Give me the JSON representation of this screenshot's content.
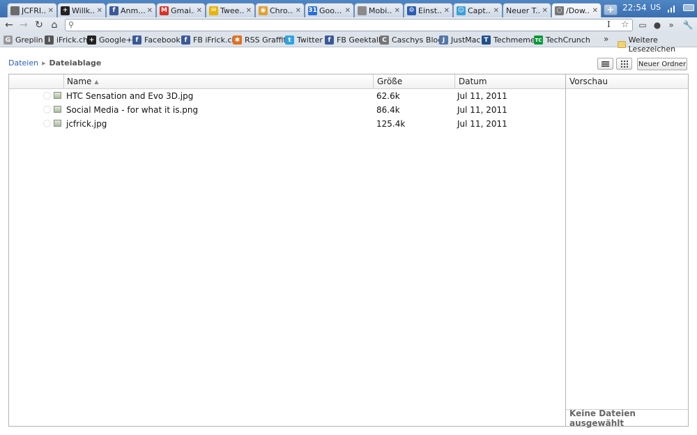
{
  "tabs": [
    {
      "title": "JCFRI...",
      "icon": "site-icon",
      "color": "#6b6b6b",
      "glyph": ""
    },
    {
      "title": "Willk...",
      "icon": "google-plus-icon",
      "color": "#222222",
      "glyph": "+"
    },
    {
      "title": "Anm...",
      "icon": "facebook-icon",
      "color": "#3b5998",
      "glyph": "f"
    },
    {
      "title": "Gmai...",
      "icon": "gmail-icon",
      "color": "#d93025",
      "glyph": "M"
    },
    {
      "title": "Twee...",
      "icon": "tweetdeck-icon",
      "color": "#e8b400",
      "glyph": "✉"
    },
    {
      "title": "Chro...",
      "icon": "chrome-icon",
      "color": "#e0a030",
      "glyph": "◉"
    },
    {
      "title": "Goo...",
      "icon": "google-calendar-icon",
      "color": "#2a6fd6",
      "glyph": "31"
    },
    {
      "title": "Mobi...",
      "icon": "apple-icon",
      "color": "#8a8a8a",
      "glyph": ""
    },
    {
      "title": "Einst...",
      "icon": "wrench-icon",
      "color": "#2a5db0",
      "glyph": "⚙"
    },
    {
      "title": "Capt...",
      "icon": "capture-icon",
      "color": "#3aa0d8",
      "glyph": "☺"
    },
    {
      "title": "Neuer T...",
      "icon": "",
      "color": "",
      "glyph": ""
    },
    {
      "title": "/Dow...",
      "icon": "loading-icon",
      "color": "#777777",
      "glyph": "○"
    }
  ],
  "system": {
    "new_tab": "+",
    "clock": "22:54",
    "keyboard_layout": "US"
  },
  "toolbar": {
    "omnibox_value": "",
    "omnibox_ibeam": "I"
  },
  "bookmarks": [
    {
      "label": "Greplin",
      "icon": "greplin-icon",
      "color": "#9a9a9a",
      "glyph": "G"
    },
    {
      "label": "iFrick.ch",
      "icon": "ifrick-icon",
      "color": "#555555",
      "glyph": "i"
    },
    {
      "label": "Google+",
      "icon": "google-plus-icon",
      "color": "#222222",
      "glyph": "+"
    },
    {
      "label": "Facebook",
      "icon": "facebook-icon",
      "color": "#3b5998",
      "glyph": "f"
    },
    {
      "label": "FB iFrick.ch",
      "icon": "facebook-icon",
      "color": "#3b5998",
      "glyph": "f"
    },
    {
      "label": "RSS Graffiti",
      "icon": "rss-graffiti-icon",
      "color": "#e07020",
      "glyph": "✱"
    },
    {
      "label": "Twitter",
      "icon": "twitter-icon",
      "color": "#2fa3e0",
      "glyph": "t"
    },
    {
      "label": "FB Geektalk",
      "icon": "facebook-icon",
      "color": "#3b5998",
      "glyph": "f"
    },
    {
      "label": "Caschys Blog",
      "icon": "caschy-icon",
      "color": "#777777",
      "glyph": "C"
    },
    {
      "label": "JustMac",
      "icon": "justmac-icon",
      "color": "#5577aa",
      "glyph": "J"
    },
    {
      "label": "Techmeme",
      "icon": "techmeme-icon",
      "color": "#1f4f8a",
      "glyph": "T"
    },
    {
      "label": "TechCrunch",
      "icon": "techcrunch-icon",
      "color": "#0a9a3a",
      "glyph": "TC"
    }
  ],
  "bookmarks_overflow": "»",
  "other_bookmarks": "Weitere Lesezeichen",
  "breadcrumb": {
    "root": "Dateien",
    "current": "Dateiablage"
  },
  "new_folder_label": "Neuer Ordner",
  "columns": {
    "name": "Name",
    "size": "Größe",
    "date": "Datum",
    "preview": "Vorschau"
  },
  "files": [
    {
      "name": "HTC Sensation and Evo 3D.jpg",
      "size": "62.6k",
      "date": "Jul 11, 2011"
    },
    {
      "name": "Social Media - for what it is.png",
      "size": "86.4k",
      "date": "Jul 11, 2011"
    },
    {
      "name": "jcfrick.jpg",
      "size": "125.4k",
      "date": "Jul 11, 2011"
    }
  ],
  "preview_status": "Keine Dateien ausgewählt"
}
